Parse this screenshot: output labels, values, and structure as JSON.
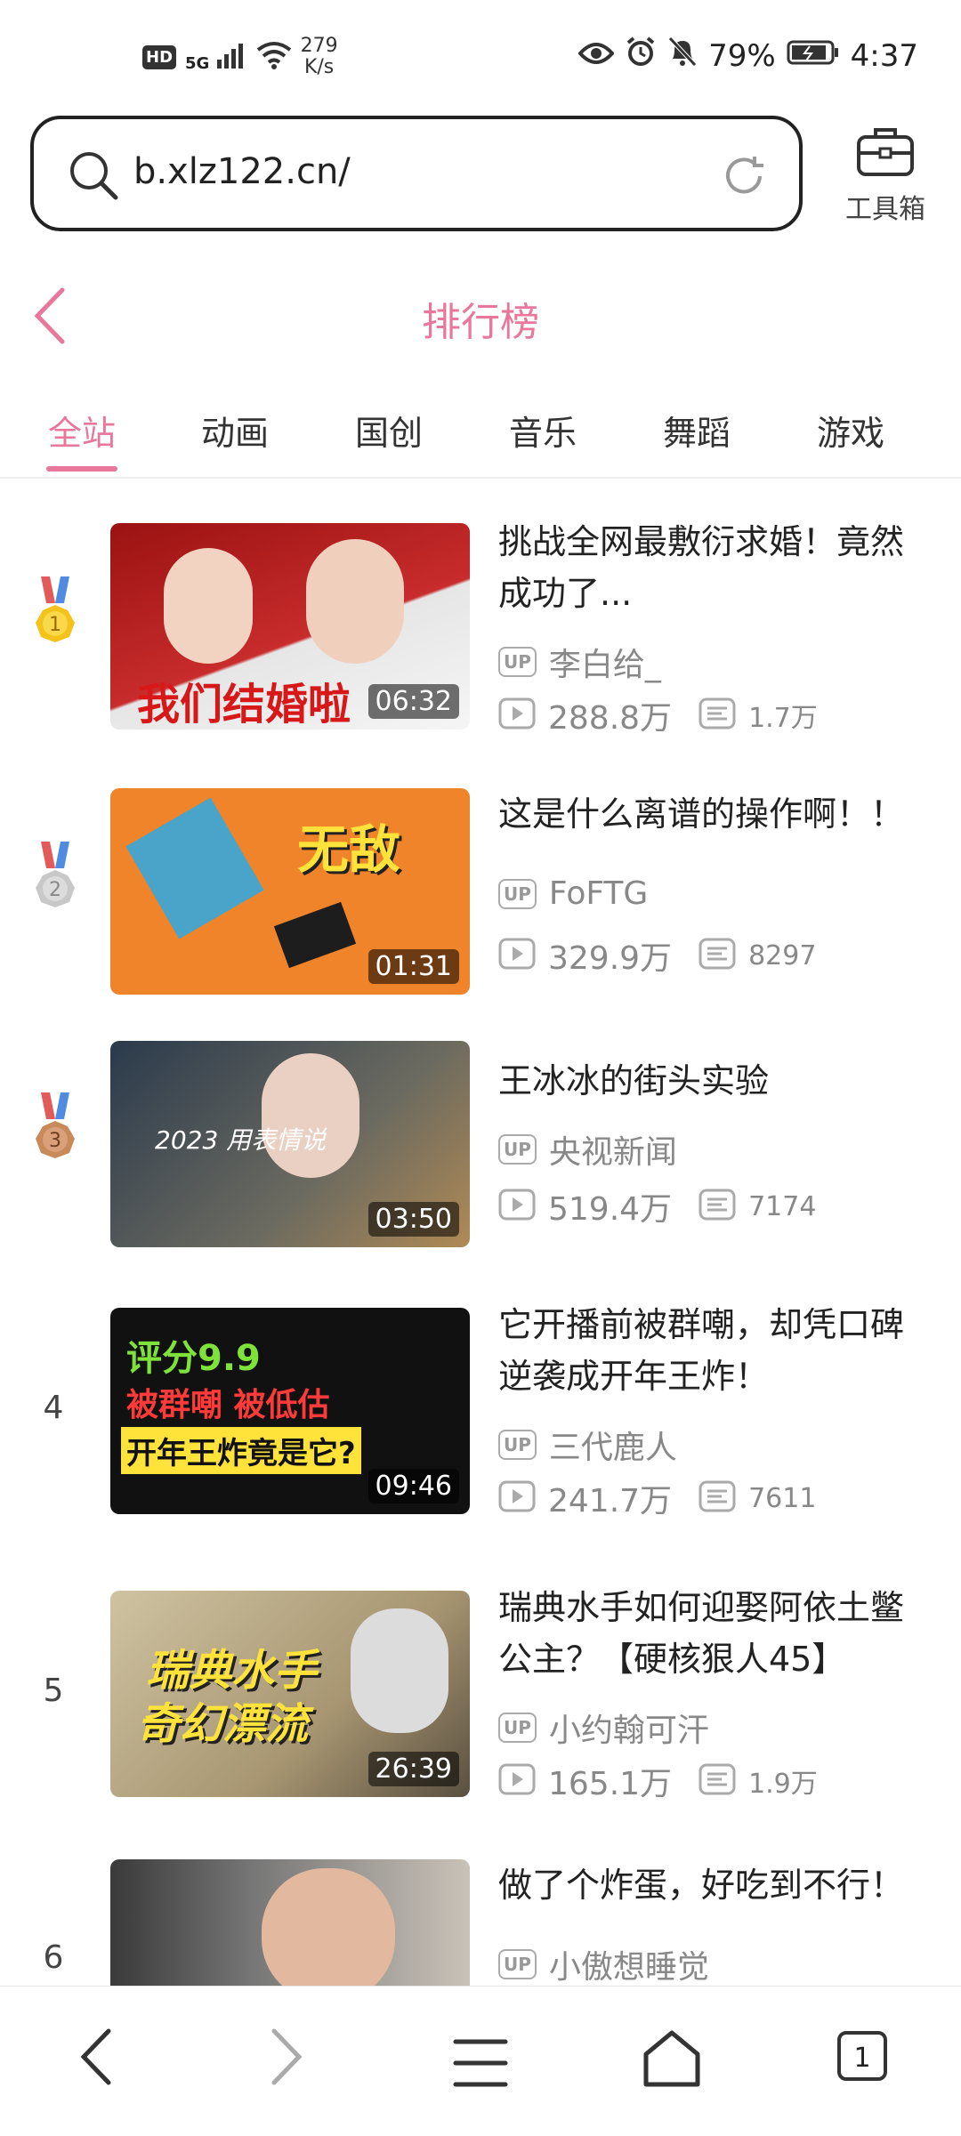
{
  "status_bar": {
    "hd": "HD",
    "network": "5G",
    "speed_value": "279",
    "speed_unit": "K/s",
    "battery": "79%",
    "time": "4:37"
  },
  "address_bar": {
    "url": "b.xlz122.cn/",
    "toolbox_label": "工具箱"
  },
  "header": {
    "title": "排行榜"
  },
  "tabs": [
    {
      "label": "全站",
      "active": true
    },
    {
      "label": "动画"
    },
    {
      "label": "国创"
    },
    {
      "label": "音乐"
    },
    {
      "label": "舞蹈"
    },
    {
      "label": "游戏"
    }
  ],
  "videos": [
    {
      "rank": "1",
      "title": "挑战全网最敷衍求婚！竟然成功了...",
      "up": "李白给_",
      "views": "288.8万",
      "danmaku": "1.7万",
      "duration": "06:32",
      "thumb_text": "我们结婚啦"
    },
    {
      "rank": "2",
      "title": "这是什么离谱的操作啊！！",
      "up": "FoFTG",
      "views": "329.9万",
      "danmaku": "8297",
      "duration": "01:31",
      "thumb_text": "无敌"
    },
    {
      "rank": "3",
      "title": "王冰冰的街头实验",
      "up": "央视新闻",
      "views": "519.4万",
      "danmaku": "7174",
      "duration": "03:50",
      "thumb_text": "2023 用表情说"
    },
    {
      "rank": "4",
      "title": "它开播前被群嘲，却凭口碑逆袭成开年王炸！",
      "up": "三代鹿人",
      "views": "241.7万",
      "danmaku": "7611",
      "duration": "09:46",
      "thumb_text_1": "评分9.9",
      "thumb_text_2": "被群嘲 被低估",
      "thumb_text_3": "开年王炸竟是它?"
    },
    {
      "rank": "5",
      "title": "瑞典水手如何迎娶阿依土鳖公主？【硬核狠人45】",
      "up": "小约翰可汗",
      "views": "165.1万",
      "danmaku": "1.9万",
      "duration": "26:39",
      "thumb_text_1": "瑞典水手",
      "thumb_text_2": "奇幻漂流"
    },
    {
      "rank": "6",
      "title": "做了个炸蛋，好吃到不行！",
      "up": "小傲想睡觉"
    }
  ],
  "up_badge": "UP",
  "bottom_nav": {
    "tab_count": "1"
  },
  "colors": {
    "accent": "#e8779b",
    "gold": "#f4c21a",
    "silver": "#c8c8c8",
    "bronze": "#c98a5a"
  }
}
